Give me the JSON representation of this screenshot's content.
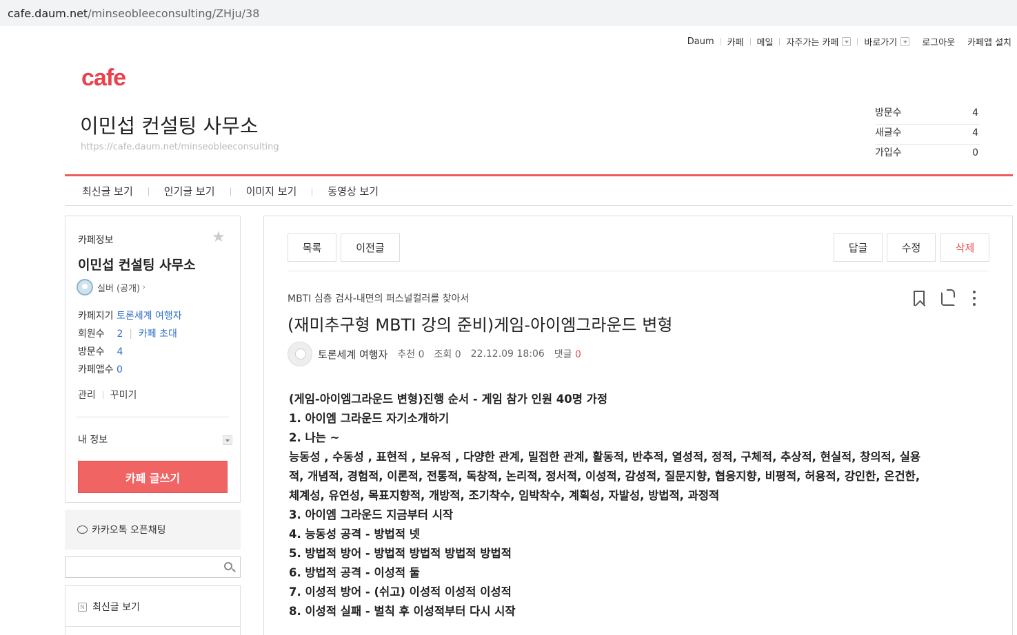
{
  "browser": {
    "url_host": "cafe.daum.net",
    "url_path": "/minseobleeconsulting/ZHju/38"
  },
  "gnb": {
    "daum": "Daum",
    "cafe": "카페",
    "mail": "메일",
    "favorite": "자주가는 카페",
    "shortcut": "바로가기",
    "logout": "로그아웃",
    "install": "카페앱 설치"
  },
  "header": {
    "logo": "cafe",
    "cafe_name": "이민섭 컨설팅 사무소",
    "cafe_url": "https://cafe.daum.net/minseobleeconsulting",
    "stats": [
      {
        "label": "방문수",
        "value": "4"
      },
      {
        "label": "새글수",
        "value": "4"
      },
      {
        "label": "가입수",
        "value": "0"
      }
    ]
  },
  "subnav": [
    "최신글 보기",
    "인기글 보기",
    "이미지 보기",
    "동영상 보기"
  ],
  "sidebar": {
    "cafe_info_label": "카페정보",
    "cafe_name": "이민섭 컨설팅 사무소",
    "grade": "실버 (공개)",
    "grade_arrow": "›",
    "keeper_label": "카페지기",
    "keeper_name": "토론세계 여행자",
    "members_label": "회원수",
    "members_value": "2",
    "invite": "카페 초대",
    "visits_label": "방문수",
    "visits_value": "4",
    "app_label": "카페앱수",
    "app_value": "0",
    "manage": "관리",
    "decorate": "꾸미기",
    "my_info": "내 정보",
    "write_button": "카페 글쓰기",
    "kakao_openchat": "카카오톡 오픈채팅",
    "search_placeholder": "",
    "recent_posts": "최신글 보기",
    "recent_icon": "N"
  },
  "article": {
    "buttons": {
      "list": "목록",
      "prev": "이전글",
      "reply": "답글",
      "edit": "수정",
      "delete": "삭제"
    },
    "category": "MBTI 심층 검사-내면의 퍼스널컬러를 찾아서",
    "title": "(재미추구형 MBTI 강의 준비)게임-아이엠그라운드 변형",
    "author": "토론세계 여행자",
    "recommend": "추천 0",
    "views": "조회 0",
    "date": "22.12.09 18:06",
    "comments_label": "댓글",
    "comments_count": "0",
    "body": [
      "(게임-아이엠그라운드 변형)진행 순서 - 게임 참가 인원 40명 가정",
      "1. 아이엠 그라운드 자기소개하기",
      "2. 나는 ~",
      "능동성 , 수동성 , 표현적 , 보유적 , 다양한 관계, 밀접한 관계, 활동적, 반추적, 열성적, 정적, 구체적, 추상적, 현실적, 창의적, 실용",
      "적, 개념적, 경험적, 이론적, 전통적, 독창적, 논리적, 정서적, 이성적, 감성적, 질문지향, 협응지향, 비평적, 허용적, 강인한, 온건한,",
      "체계성, 유연성, 목표지향적, 개방적, 조기착수, 임박착수, 계획성, 자발성, 방법적, 과정적",
      "3. 아이엠 그라운드 지금부터 시작",
      "4. 능동성 공격 - 방법적 넷",
      "5. 방법적 방어 - 방법적 방법적 방법적 방법적",
      "6. 방법적 공격 - 이성적 둘",
      "7. 이성적 방어 - (쉬고) 이성적 이성적 이성적",
      "8. 이성적 실패 - 벌칙 후 이성적부터 다시 시작"
    ]
  },
  "colors": {
    "accent": "#e8424e",
    "button_red": "#f06464",
    "link_blue": "#2f6ec7"
  }
}
